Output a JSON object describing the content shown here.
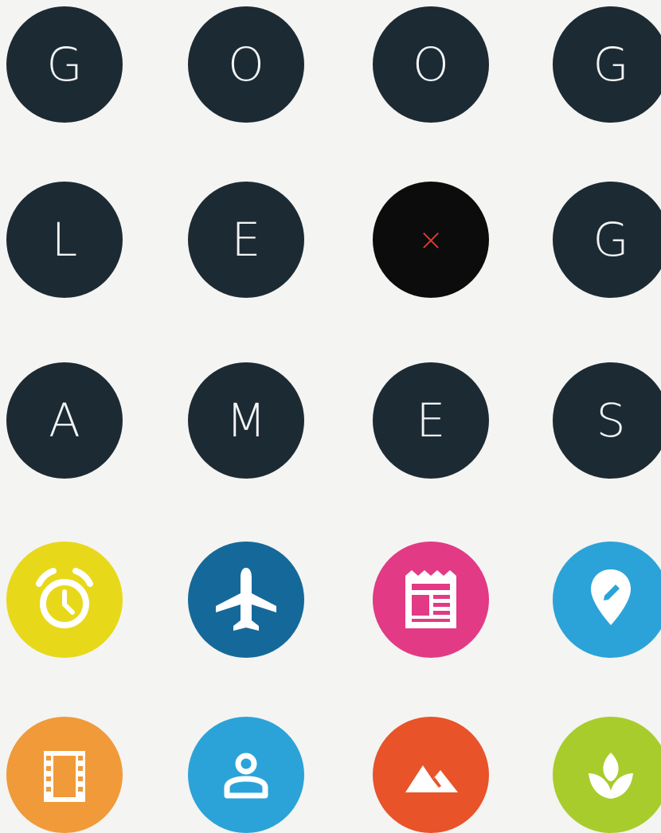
{
  "letters": {
    "r1c1": "G",
    "r1c2": "O",
    "r1c3": "O",
    "r1c4": "G",
    "r2c1": "L",
    "r2c2": "E",
    "r2c3": "×",
    "r2c4": "G",
    "r3c1": "A",
    "r3c2": "M",
    "r3c3": "E",
    "r3c4": "S"
  },
  "colors": {
    "letter_circle": "#1c2a33",
    "x_circle": "#0c0c0c",
    "x_mark": "#e23b2c",
    "alarm": "#e8d81a",
    "flight": "#15699a",
    "news": "#e23a84",
    "maps": "#2ba3d8",
    "movies": "#f09a3a",
    "contacts": "#2ba3d8",
    "photos": "#e8532a",
    "fit": "#a8cc2c"
  },
  "icons": [
    "alarm-clock-icon",
    "airplane-icon",
    "newspaper-icon",
    "map-pin-pencil-icon",
    "film-strip-icon",
    "person-icon",
    "mountains-icon",
    "leaf-icon"
  ]
}
